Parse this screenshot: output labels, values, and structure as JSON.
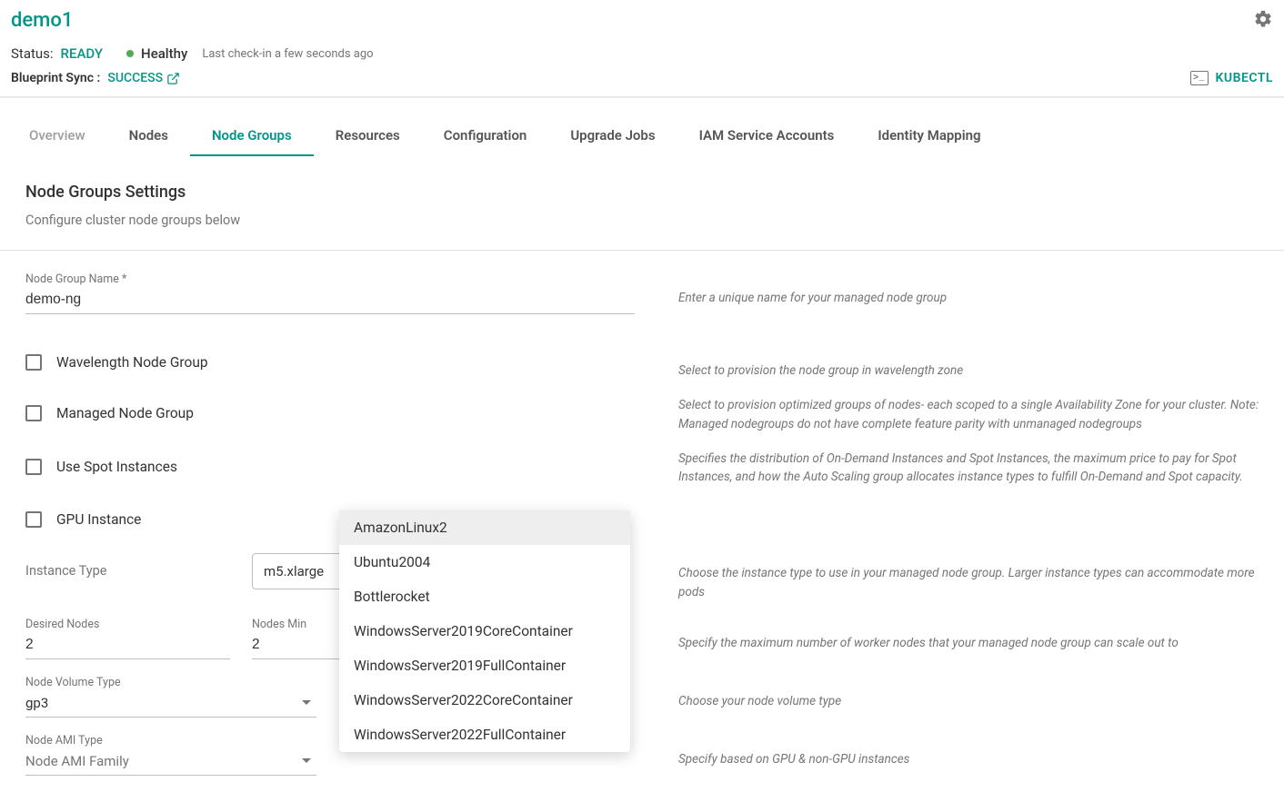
{
  "header": {
    "title": "demo1",
    "status_label": "Status:",
    "status_value": "READY",
    "health_text": "Healthy",
    "last_checkin": "Last check-in a few seconds ago",
    "sync_label": "Blueprint Sync :",
    "sync_value": "SUCCESS",
    "kubectl_label": "KUBECTL"
  },
  "tabs": [
    {
      "label": "Overview",
      "active": false
    },
    {
      "label": "Nodes",
      "active": false
    },
    {
      "label": "Node Groups",
      "active": true
    },
    {
      "label": "Resources",
      "active": false
    },
    {
      "label": "Configuration",
      "active": false
    },
    {
      "label": "Upgrade Jobs",
      "active": false
    },
    {
      "label": "IAM Service Accounts",
      "active": false
    },
    {
      "label": "Identity Mapping",
      "active": false
    }
  ],
  "section": {
    "title": "Node Groups Settings",
    "description": "Configure cluster node groups below"
  },
  "form": {
    "name_label": "Node Group Name *",
    "name_value": "demo-ng",
    "name_help": "Enter a unique name for your managed node group",
    "wavelength_label": "Wavelength Node Group",
    "wavelength_help": "Select to provision the node group in wavelength zone",
    "managed_label": "Managed Node Group",
    "managed_help": "Select to provision optimized groups of nodes- each scoped to a single Availability Zone for your cluster. Note: Managed nodegroups do not have complete feature parity with unmanaged nodegroups",
    "spot_label": "Use Spot Instances",
    "spot_help": "Specifies the distribution of On-Demand Instances and Spot Instances, the maximum price to pay for Spot Instances, and how the Auto Scaling group allocates instance types to fulfill On-Demand and Spot capacity.",
    "gpu_label": "GPU Instance",
    "instance_type_label": "Instance Type",
    "instance_type_value": "m5.xlarge",
    "instance_type_help": "Choose the instance type to use in your managed node group. Larger instance types can accommodate more pods",
    "desired_label": "Desired Nodes",
    "desired_value": "2",
    "min_label": "Nodes Min",
    "min_value": "2",
    "nodes_help": "Specify the maximum number of worker nodes that your managed node group can scale out to",
    "volume_type_label": "Node Volume Type",
    "volume_type_value": "gp3",
    "volume_type_help": "Choose your node volume type",
    "ami_type_label": "Node AMI Type",
    "ami_type_placeholder": "Node AMI Family",
    "ami_type_help": "Specify based on GPU & non-GPU instances"
  },
  "dropdown_options": [
    "AmazonLinux2",
    "Ubuntu2004",
    "Bottlerocket",
    "WindowsServer2019CoreContainer",
    "WindowsServer2019FullContainer",
    "WindowsServer2022CoreContainer",
    "WindowsServer2022FullContainer"
  ]
}
